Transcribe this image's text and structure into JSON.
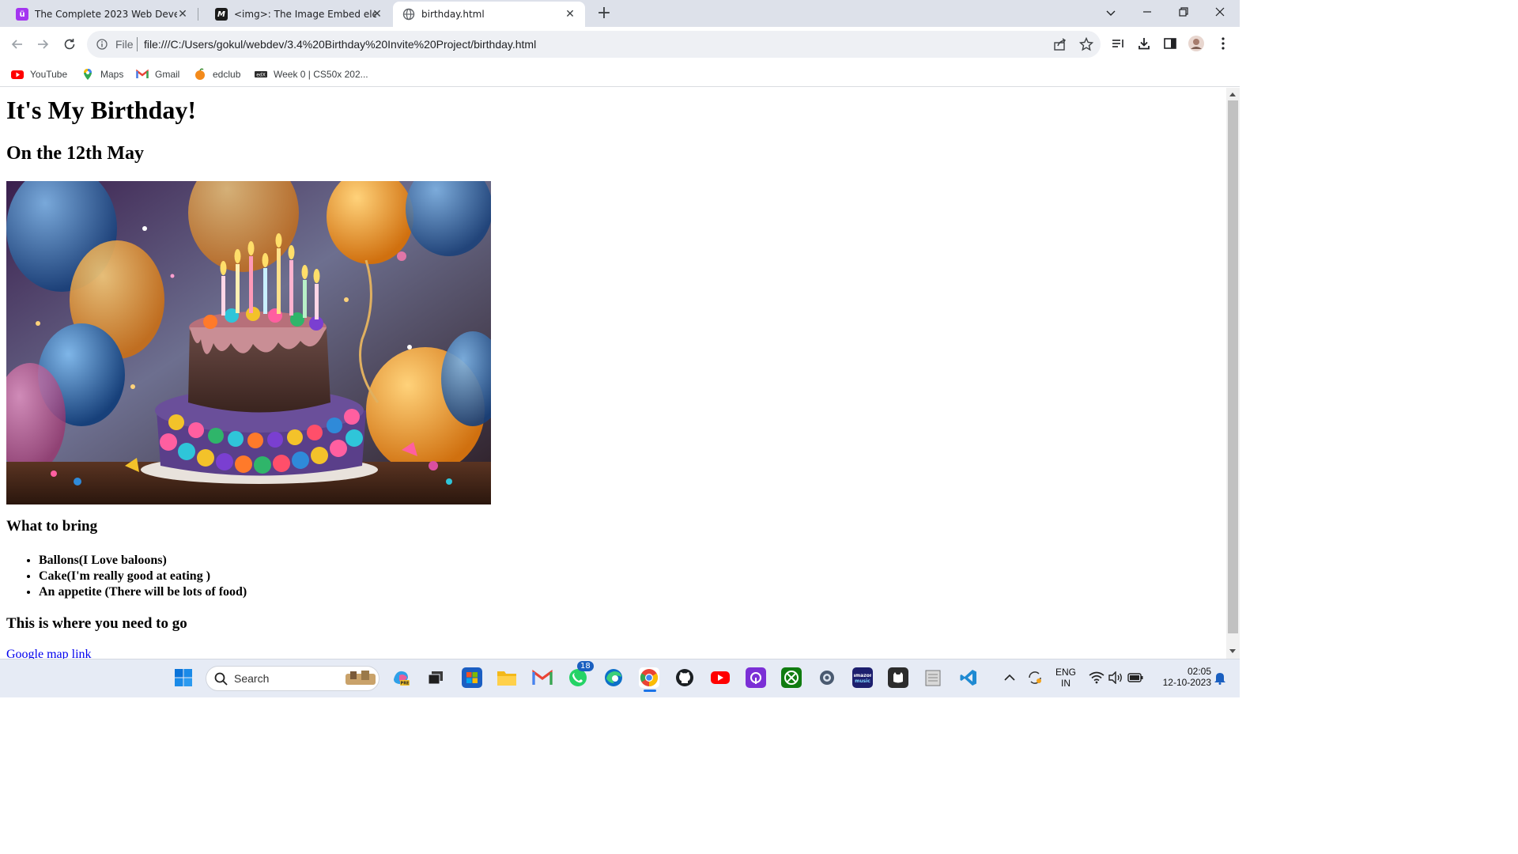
{
  "browser": {
    "tabs": [
      {
        "title": "The Complete 2023 Web Develop",
        "favicon": "udemy-icon",
        "active": false
      },
      {
        "title": "<img>: The Image Embed eleme",
        "favicon": "mdn-icon",
        "active": false
      },
      {
        "title": "birthday.html",
        "favicon": "globe-icon",
        "active": true
      }
    ],
    "address": {
      "scheme_label": "File",
      "url": "file:///C:/Users/gokul/webdev/3.4%20Birthday%20Invite%20Project/birthday.html"
    },
    "bookmarks": [
      {
        "label": "YouTube",
        "icon": "youtube-icon"
      },
      {
        "label": "Maps",
        "icon": "maps-icon"
      },
      {
        "label": "Gmail",
        "icon": "gmail-icon"
      },
      {
        "label": "edclub",
        "icon": "edclub-icon"
      },
      {
        "label": "Week 0 | CS50x 202...",
        "icon": "cs50-icon"
      }
    ]
  },
  "page": {
    "title": "It's My Birthday!",
    "date": "On the 12th May",
    "what_to_bring_heading": "What to bring",
    "items": [
      "Ballons(I Love baloons)",
      "Cake(I'm really good at eating )",
      "An appetite (There will be lots of food)"
    ],
    "where_heading": "This is where you need to go",
    "map_link": "Google map link"
  },
  "taskbar": {
    "search_label": "Search",
    "whatsapp_badge": "18",
    "language": {
      "line1": "ENG",
      "line2": "IN"
    },
    "clock": {
      "time": "02:05",
      "date": "12-10-2023"
    }
  },
  "colors": {
    "accent": "#1a73e8",
    "link": "#0000ee",
    "tabstrip": "#dde1ea"
  }
}
